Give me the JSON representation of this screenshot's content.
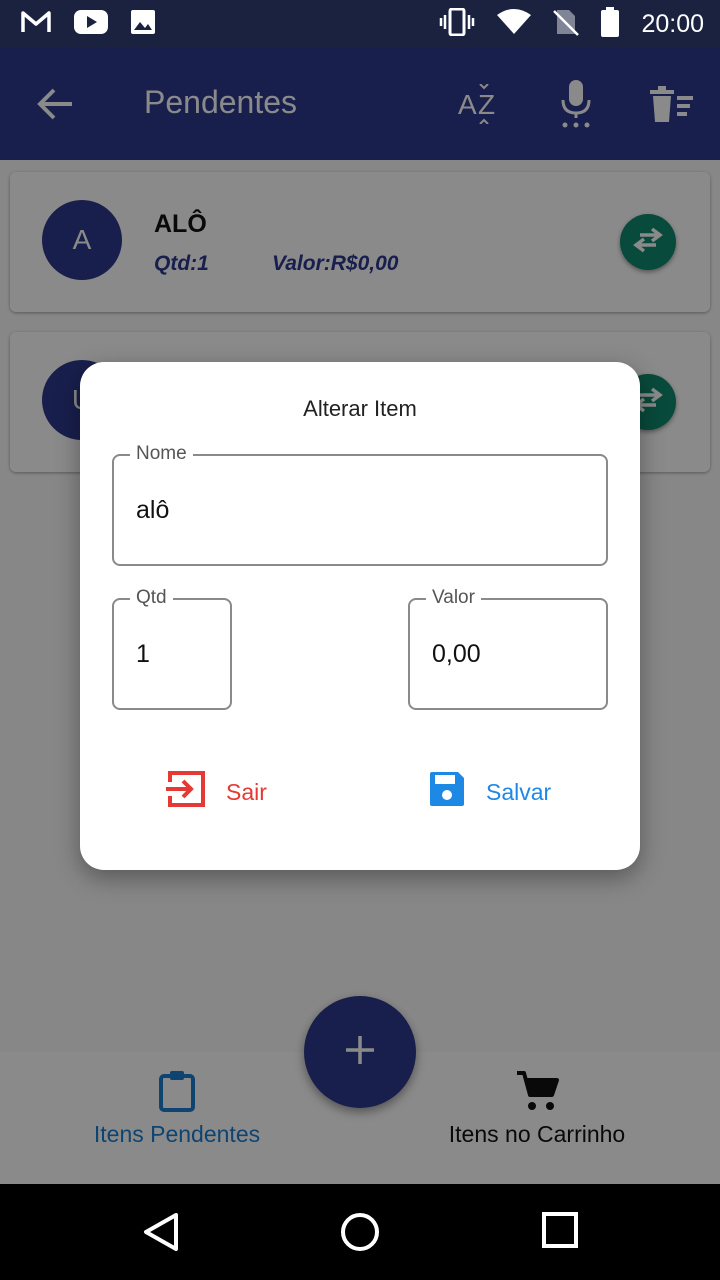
{
  "status_bar": {
    "time": "20:00",
    "left_icons": [
      "gmail-icon",
      "youtube-icon",
      "image-icon"
    ],
    "right_icons": [
      "vibrate-icon",
      "wifi-icon",
      "no-sim-icon",
      "battery-icon"
    ]
  },
  "app_bar": {
    "title": "Pendentes",
    "actions": [
      "sort-az-icon",
      "mic-icon",
      "clear-list-icon"
    ]
  },
  "items": [
    {
      "avatar": "A",
      "name": "ALÔ",
      "qtd": "Qtd:1",
      "valor": "Valor:R$0,00"
    },
    {
      "avatar": "U"
    }
  ],
  "dialog": {
    "title": "Alterar Item",
    "nome_label": "Nome",
    "nome_value": "alô",
    "qtd_label": "Qtd",
    "qtd_value": "1",
    "valor_label": "Valor",
    "valor_value": "0,00",
    "sair_label": "Sair",
    "salvar_label": "Salvar"
  },
  "bottom_nav": {
    "pendentes_label": "Itens Pendentes",
    "carrinho_label": "Itens no Carrinho"
  },
  "colors": {
    "primary": "#2d3a8c",
    "status_bar": "#1a2240",
    "swap_button": "#0f8a6e",
    "sair": "#e53935",
    "salvar": "#1e88e5",
    "active_nav": "#1d7fd1"
  }
}
